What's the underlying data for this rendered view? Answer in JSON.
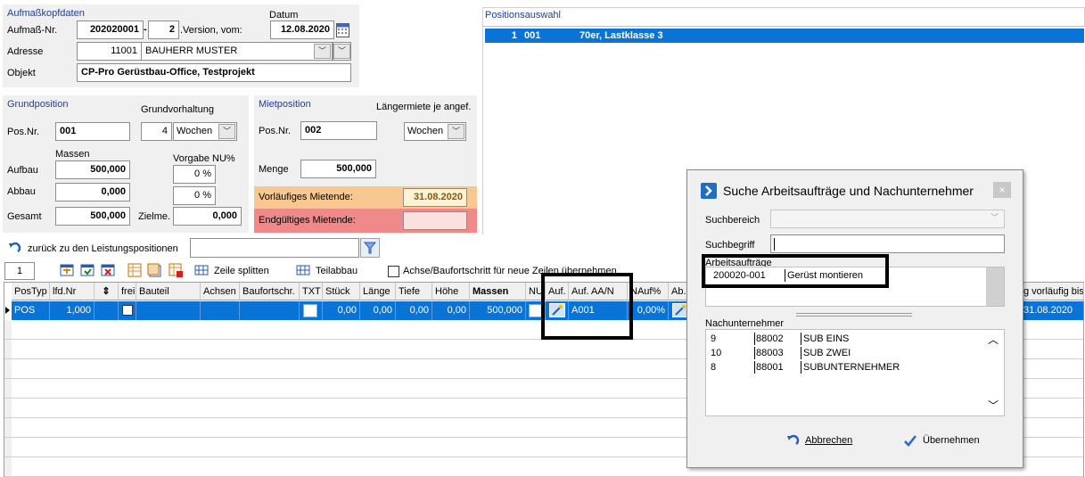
{
  "header": {
    "title": "Aufmaßkopfdaten",
    "aufmass_label": "Aufmaß-Nr.",
    "aufmass_nr": "202020001",
    "separator": "-",
    "version": "2",
    "version_label": ".Version, vom:",
    "datum_label": "Datum",
    "datum": "12.08.2020",
    "adresse_label": "Adresse",
    "adresse_nr": "11001",
    "adresse_name": "BAUHERR MUSTER",
    "objekt_label": "Objekt",
    "objekt": "CP-Pro Gerüstbau-Office, Testprojekt"
  },
  "positionsauswahl": {
    "title": "Positionsauswahl",
    "row": {
      "num": "1",
      "code": "001",
      "text": "70er, Lastklasse 3"
    }
  },
  "grundposition": {
    "title": "Grundposition",
    "vorhaltung_label": "Grundvorhaltung",
    "posnr_label": "Pos.Nr.",
    "posnr": "001",
    "vorhaltung_value": "4",
    "vorhaltung_unit": "Wochen",
    "massen_label": "Massen",
    "vorgabe_label": "Vorgabe NU%",
    "aufbau_label": "Aufbau",
    "aufbau": "500,000",
    "aufbau_pct": "0 %",
    "abbau_label": "Abbau",
    "abbau": "0,000",
    "abbau_pct": "0 %",
    "gesamt_label": "Gesamt",
    "gesamt": "500,000",
    "zielme_label": "Zielme.",
    "zielme": "0,000"
  },
  "mietposition": {
    "title": "Mietposition",
    "laengermiete_label": "Längermiete je angef.",
    "posnr_label": "Pos.Nr.",
    "posnr": "002",
    "unit": "Wochen",
    "menge_label": "Menge",
    "menge": "500,000",
    "vorlaeufig_label": "Vorläufiges Mietende:",
    "vorlaeufig": "31.08.2020",
    "endgueltig_label": "Endgültiges Mietende:",
    "endgueltig": ""
  },
  "toolbar": {
    "zurueck_label": "zurück zu den Leistungspositionen",
    "search_value": "",
    "counter": "1",
    "zeile_splitten": "Zeile splitten",
    "teilabbau": "Teilabbau",
    "achse_checkbox_label": "Achse/Baufortschritt für neue Zeilen übernehmen"
  },
  "grid": {
    "columns": [
      "PosTyp",
      "lfd.Nr",
      "",
      "frei",
      "Bauteil",
      "Achsen",
      "Baufortschr.",
      "TXT",
      "Stück",
      "Länge",
      "Tiefe",
      "Höhe",
      "Massen",
      "NU",
      "Auf.",
      "Auf. AA/N",
      "NAuf%",
      "Ab.",
      "",
      "",
      "",
      "",
      "",
      "",
      "g vorläufig bis"
    ],
    "row": {
      "postyp": "POS",
      "lfdnr": "1,000",
      "stueck": "0,00",
      "laenge": "0,00",
      "tiefe": "0,00",
      "hoehe": "0,00",
      "massen": "500,000",
      "auf_aan": "A001",
      "naufpct": "0,00%",
      "vorlaeufig_bis": "31.08.2020"
    }
  },
  "dialog": {
    "title": "Suche Arbeitsaufträge und Nachunternehmer",
    "close": "×",
    "suchbereich_label": "Suchbereich",
    "suchbereich_value": "",
    "suchbegriff_label": "Suchbegriff",
    "suchbegriff_value": "",
    "arbeitsauftraege_label": "Arbeitsaufträge",
    "auftraege": [
      {
        "nr": "200020-001",
        "text": "Gerüst montieren"
      }
    ],
    "nachunternehmer_label": "Nachunternehmer",
    "nachunternehmer": [
      {
        "num": "9",
        "code": "88002",
        "name": "SUB EINS"
      },
      {
        "num": "10",
        "code": "88003",
        "name": "SUB ZWEI"
      },
      {
        "num": "8",
        "code": "88001",
        "name": "SUBUNTERNEHMER"
      }
    ],
    "abbrechen": "Abbrechen",
    "uebernehmen": "Übernehmen"
  },
  "colors": {
    "title_blue": "#1a3fa0",
    "selection_blue": "#0a74d6",
    "orange_bg": "#f8c890",
    "red_bg": "#f08a8a"
  }
}
